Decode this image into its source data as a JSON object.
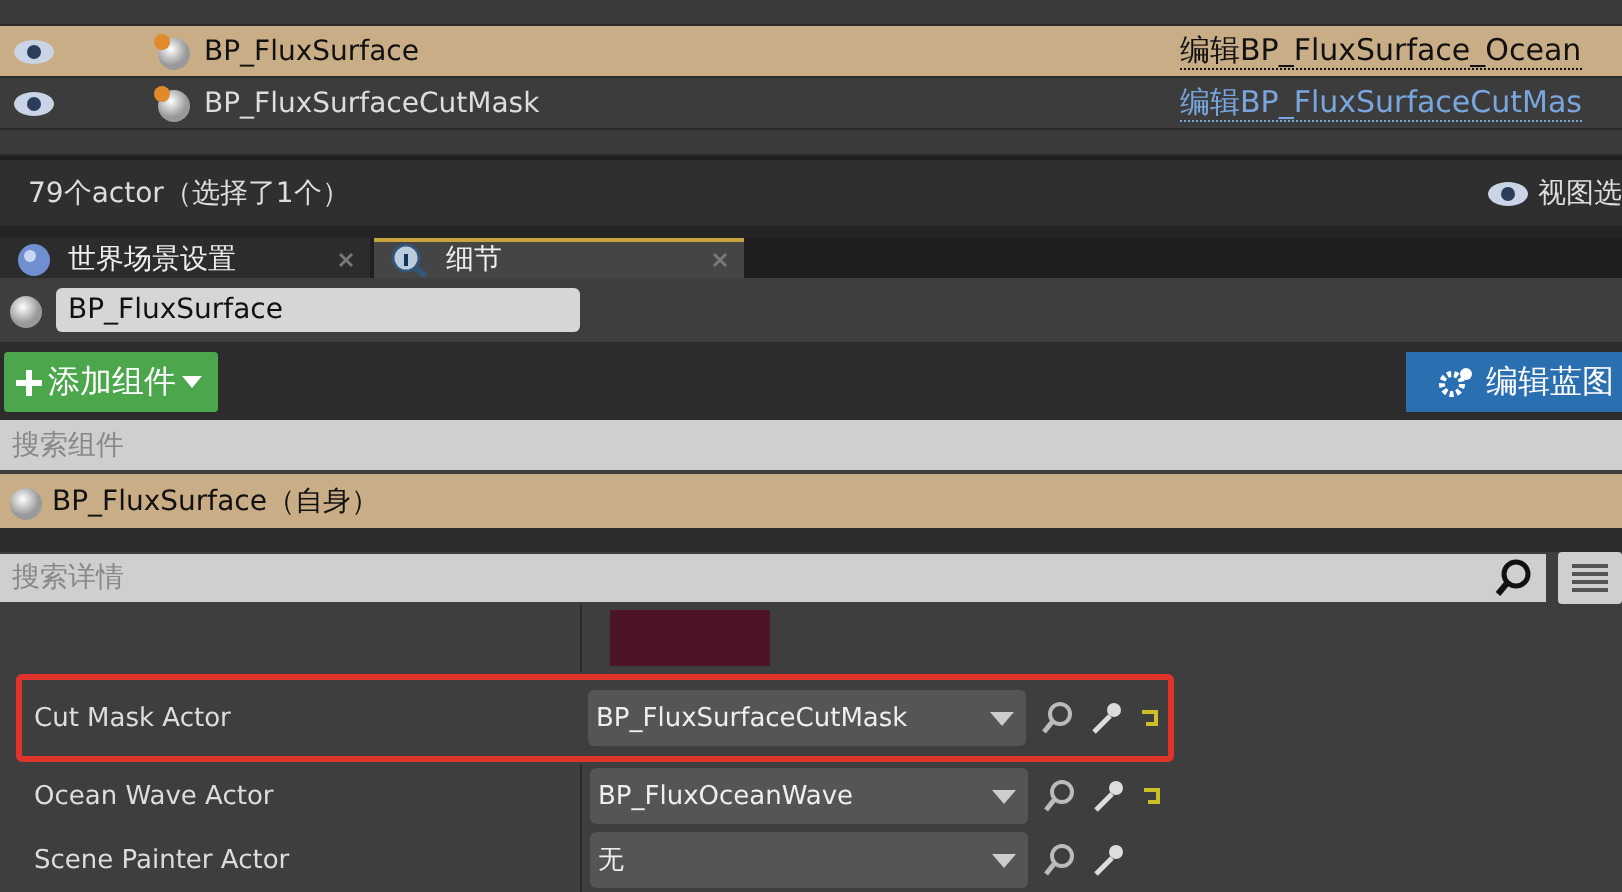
{
  "outliner": {
    "rows": [
      {
        "label": "BP_FluxSurface",
        "link": "编辑BP_FluxSurface_Ocean",
        "selected": true
      },
      {
        "label": "BP_FluxSurfaceCutMask",
        "link": "编辑BP_FluxSurfaceCutMas",
        "selected": false
      }
    ],
    "status": "79个actor（选择了1个）",
    "view_options": "视图选"
  },
  "tabs": [
    {
      "label": "世界场景设置",
      "selected": false,
      "kind": "world"
    },
    {
      "label": "细节",
      "selected": true,
      "kind": "details"
    }
  ],
  "actor_name": "BP_FluxSurface",
  "add_component": "添加组件",
  "edit_blueprint": "编辑蓝图",
  "component_search": {
    "placeholder": "搜索组件"
  },
  "components": [
    {
      "label": "BP_FluxSurface（自身）",
      "selected": true
    }
  ],
  "details_search": {
    "placeholder": "搜索详情"
  },
  "properties": [
    {
      "label": "Cut Mask Actor",
      "value": "BP_FluxSurfaceCutMask",
      "highlighted": true,
      "reset": true
    },
    {
      "label": "Ocean Wave Actor",
      "value": "BP_FluxOceanWave",
      "highlighted": false,
      "reset": true
    },
    {
      "label": "Scene Painter Actor",
      "value": "无",
      "highlighted": false,
      "reset": false
    }
  ]
}
